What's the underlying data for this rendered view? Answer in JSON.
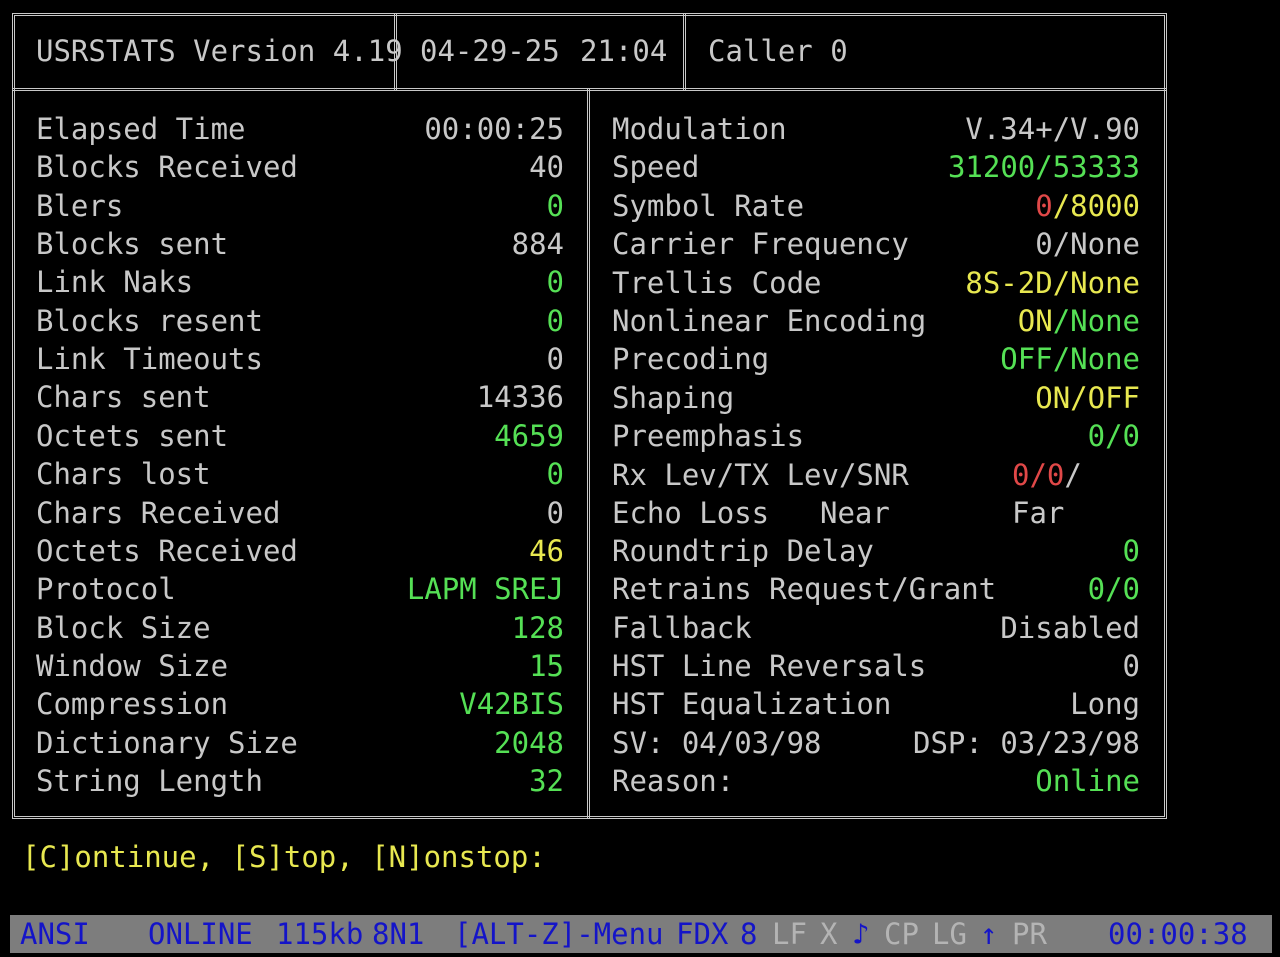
{
  "header": {
    "title": "USRSTATS Version 4.19",
    "date": "04-29-25",
    "time": "21:04",
    "caller": "Caller 0"
  },
  "left_stats": [
    {
      "label": "Elapsed Time",
      "value": "00:00:25",
      "color": "#c8c8c8"
    },
    {
      "label": "Blocks Received",
      "value": "40",
      "color": "#c8c8c8"
    },
    {
      "label": "Blers",
      "value": "0",
      "color": "#55e055"
    },
    {
      "label": "Blocks sent",
      "value": "884",
      "color": "#c8c8c8"
    },
    {
      "label": "Link Naks",
      "value": "0",
      "color": "#55e055"
    },
    {
      "label": "Blocks resent",
      "value": "0",
      "color": "#55e055"
    },
    {
      "label": "Link Timeouts",
      "value": "0",
      "color": "#c8c8c8"
    },
    {
      "label": "Chars sent",
      "value": "14336",
      "color": "#c8c8c8"
    },
    {
      "label": "Octets sent",
      "value": "4659",
      "color": "#55e055"
    },
    {
      "label": "Chars lost",
      "value": "0",
      "color": "#55e055"
    },
    {
      "label": "Chars Received",
      "value": "0",
      "color": "#c8c8c8"
    },
    {
      "label": "Octets Received",
      "value": "46",
      "color": "#e8e850"
    },
    {
      "label": "Protocol",
      "value": "LAPM SREJ",
      "color": "#55e055"
    },
    {
      "label": "Block Size",
      "value": "128",
      "color": "#55e055"
    },
    {
      "label": "Window Size",
      "value": "15",
      "color": "#55e055"
    },
    {
      "label": "Compression",
      "value": "V42BIS",
      "color": "#55e055"
    },
    {
      "label": "Dictionary Size",
      "value": "2048",
      "color": "#55e055"
    },
    {
      "label": "String Length",
      "value": "32",
      "color": "#55e055"
    }
  ],
  "right_stats": {
    "modulation": {
      "label": "Modulation",
      "value": "V.34+/V.90"
    },
    "speed": {
      "label": "Speed",
      "value": "31200/53333"
    },
    "symbol_rate": {
      "label": "Symbol Rate",
      "value_a": "0",
      "value_b": "/8000"
    },
    "carrier_frequency": {
      "label": "Carrier Frequency",
      "value": "0/None"
    },
    "trellis_code": {
      "label": "Trellis Code",
      "value_a": "8S-2D",
      "value_b": "/None"
    },
    "nonlinear_encoding": {
      "label": "Nonlinear Encoding",
      "value_a": "ON",
      "value_b": "/None"
    },
    "precoding": {
      "label": "Precoding",
      "value_a": "OFF",
      "value_b": "/None"
    },
    "shaping": {
      "label": "Shaping",
      "value_a": "ON",
      "value_b": "/OFF"
    },
    "preemphasis": {
      "label": "Preemphasis",
      "value": "0/0"
    },
    "rx_tx_snr": {
      "label": "Rx Lev/TX Lev/SNR",
      "value_a": "0/0",
      "value_b": "/"
    },
    "echo_loss": {
      "label": "Echo Loss",
      "near": "Near",
      "far": "Far"
    },
    "roundtrip_delay": {
      "label": "Roundtrip Delay",
      "value": "0"
    },
    "retrains": {
      "label": "Retrains Request/Grant",
      "value": "0/0"
    },
    "fallback": {
      "label": "Fallback",
      "value": "Disabled"
    },
    "hst_line_reversals": {
      "label": "HST Line Reversals",
      "value": "0"
    },
    "hst_equalization": {
      "label": "HST Equalization",
      "value": "Long"
    },
    "versions": {
      "sv": "SV: 04/03/98",
      "dsp": "DSP: 03/23/98"
    },
    "reason": {
      "label": "Reason:",
      "value": "Online"
    }
  },
  "prompt": "[C]ontinue, [S]top, [N]onstop:",
  "statusbar": {
    "emulation": "ANSI",
    "state": "ONLINE",
    "baud": "115kb",
    "format": "8N1",
    "menu": "[ALT-Z]-Menu",
    "duplex": "FDX",
    "bits": "8",
    "lf": "LF",
    "x": "X",
    "music": "♪",
    "cp": "CP",
    "lg": "LG",
    "arrow": "↑",
    "pr": "PR",
    "timer": "00:00:38"
  },
  "colors": {
    "background": "#000000",
    "text": "#c8c8c8",
    "green": "#55e055",
    "yellow": "#e8e850",
    "red": "#e04848",
    "status_bg": "#7d7d7d",
    "status_fg": "#1414c8"
  }
}
